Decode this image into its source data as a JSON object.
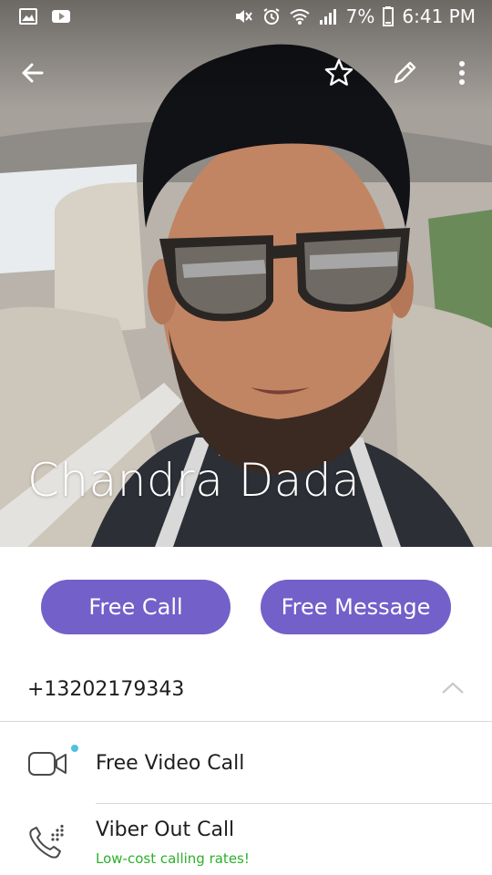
{
  "status_bar": {
    "battery_percent": "7%",
    "time": "6:41 PM",
    "left_icons": [
      "gallery-notification-icon",
      "youtube-notification-icon"
    ],
    "right_icons": [
      "mute-icon",
      "alarm-icon",
      "wifi-icon",
      "signal-icon",
      "battery-icon"
    ]
  },
  "action_bar": {
    "back_icon": "arrow-left-icon",
    "favorite_icon": "star-outline-icon",
    "edit_icon": "pencil-icon",
    "more_icon": "overflow-menu-icon"
  },
  "contact": {
    "name": "Chandra Dada",
    "phone": "+13202179343"
  },
  "buttons": {
    "free_call": "Free Call",
    "free_message": "Free Message"
  },
  "options": [
    {
      "title": "Free Video Call",
      "icon": "video-camera-icon",
      "indicator": "new-dot"
    },
    {
      "title": "Viber Out Call",
      "subtitle": "Low-cost calling rates!",
      "icon": "phone-out-icon"
    }
  ],
  "colors": {
    "accent": "#7360c9",
    "subtitle_green": "#2db02d",
    "indicator_blue": "#4fc1e1"
  }
}
